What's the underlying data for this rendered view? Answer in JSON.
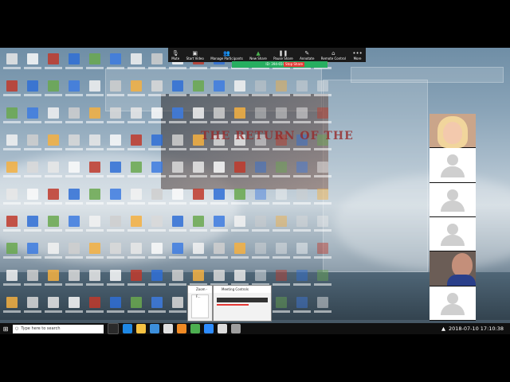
{
  "zoom_toolbar": {
    "buttons": [
      {
        "icon": "mic-icon",
        "label": "Mute"
      },
      {
        "icon": "video-icon",
        "label": "Start Video"
      },
      {
        "icon": "participants-icon",
        "label": "Manage Participants"
      },
      {
        "icon": "share-icon",
        "label": "New Share"
      },
      {
        "icon": "pause-icon",
        "label": "Pause Share"
      },
      {
        "icon": "pencil-icon",
        "label": "Annotate"
      },
      {
        "icon": "remote-icon",
        "label": "Remote Control"
      },
      {
        "icon": "more-icon",
        "label": "More"
      }
    ],
    "meeting_id": "ID: 394-650-1066",
    "stop_share": "Stop Share"
  },
  "movie_title": "THE RETURN OF THE",
  "popups": {
    "zoom_label": "Zoom - F...",
    "meeting_controls": "Meeting Controls"
  },
  "taskbar": {
    "search_placeholder": "Type here to search",
    "datetime": "2018-07-10  17:10:38"
  },
  "colors": {
    "share_green": "#27ae60",
    "stop_red": "#e53935",
    "taskbar": "#101010"
  }
}
